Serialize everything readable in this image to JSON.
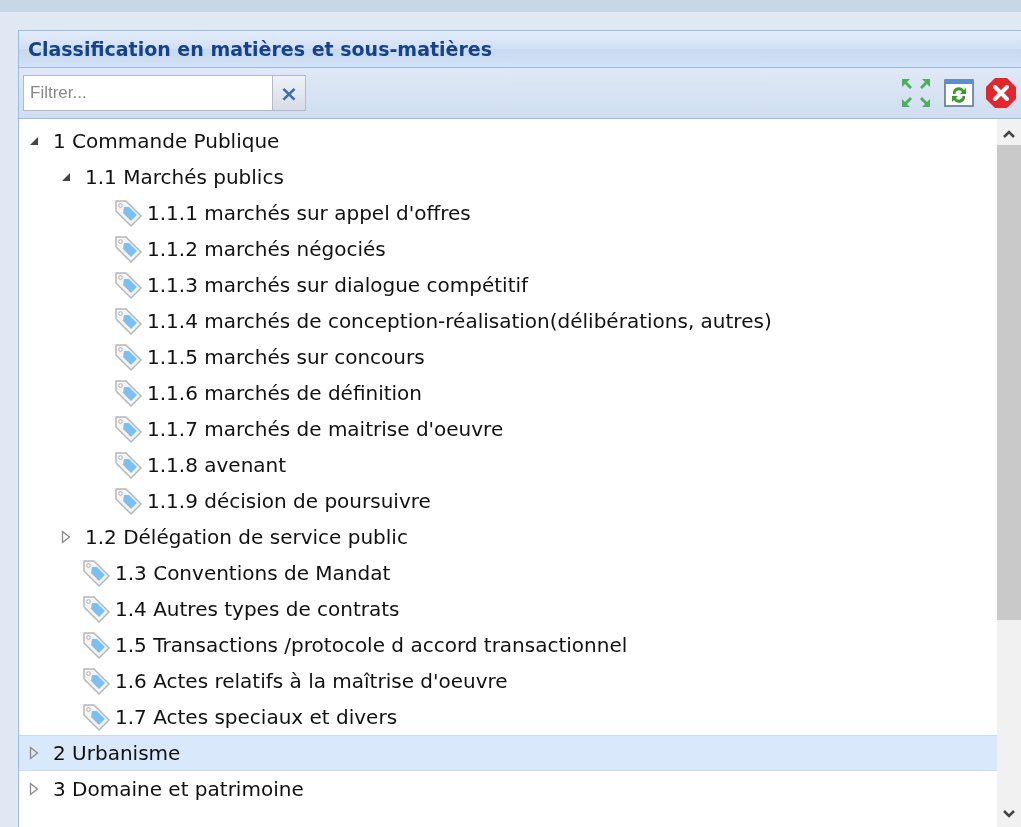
{
  "panel": {
    "title": "Classification en matières et sous-matières"
  },
  "filter": {
    "placeholder": "Filtrer...",
    "clear": "×"
  },
  "tree": [
    {
      "label": "1 Commande Publique",
      "kind": "branch",
      "expanded": true,
      "selected": false,
      "children": [
        {
          "label": "1.1 Marchés publics",
          "kind": "branch",
          "expanded": true,
          "selected": false,
          "children": [
            {
              "label": "1.1.1 marchés sur appel d'offres",
              "kind": "leaf",
              "selected": false
            },
            {
              "label": "1.1.2 marchés négociés",
              "kind": "leaf",
              "selected": false
            },
            {
              "label": "1.1.3 marchés sur dialogue compétitif",
              "kind": "leaf",
              "selected": false
            },
            {
              "label": "1.1.4 marchés de conception-réalisation(délibérations, autres)",
              "kind": "leaf",
              "selected": false
            },
            {
              "label": "1.1.5 marchés sur concours",
              "kind": "leaf",
              "selected": false
            },
            {
              "label": "1.1.6 marchés de définition",
              "kind": "leaf",
              "selected": false
            },
            {
              "label": "1.1.7 marchés de maitrise d'oeuvre",
              "kind": "leaf",
              "selected": false
            },
            {
              "label": "1.1.8 avenant",
              "kind": "leaf",
              "selected": false
            },
            {
              "label": "1.1.9 décision de poursuivre",
              "kind": "leaf",
              "selected": false
            }
          ]
        },
        {
          "label": "1.2 Délégation de service public",
          "kind": "branch",
          "expanded": false,
          "selected": false
        },
        {
          "label": "1.3 Conventions de Mandat",
          "kind": "leaf",
          "selected": false
        },
        {
          "label": "1.4 Autres types de contrats",
          "kind": "leaf",
          "selected": false
        },
        {
          "label": "1.5 Transactions /protocole d accord transactionnel",
          "kind": "leaf",
          "selected": false
        },
        {
          "label": "1.6 Actes relatifs à la maîtrise d'oeuvre",
          "kind": "leaf",
          "selected": false
        },
        {
          "label": "1.7 Actes speciaux et divers",
          "kind": "leaf",
          "selected": false
        }
      ]
    },
    {
      "label": "2 Urbanisme",
      "kind": "branch",
      "expanded": false,
      "selected": true
    },
    {
      "label": "3 Domaine et patrimoine",
      "kind": "branch",
      "expanded": false,
      "selected": false
    }
  ]
}
